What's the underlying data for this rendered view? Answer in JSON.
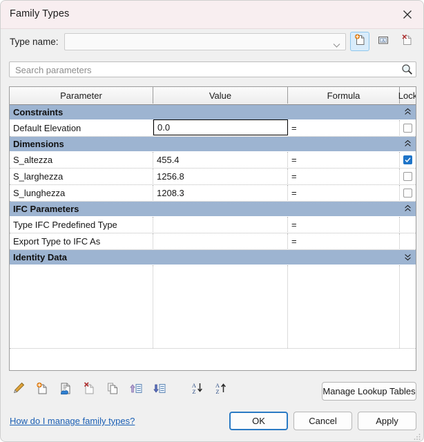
{
  "window": {
    "title": "Family Types",
    "close_icon": "close-icon"
  },
  "type_name": {
    "label": "Type name:",
    "value": "",
    "caret_icon": "chevron-down-icon",
    "buttons": [
      {
        "name": "new-type-button",
        "tooltip": "New Type",
        "icon": "new-document-icon",
        "state": "hovered"
      },
      {
        "name": "rename-type-button",
        "tooltip": "Rename",
        "icon": "rename-icon",
        "state": "normal"
      },
      {
        "name": "delete-type-button",
        "tooltip": "Delete",
        "icon": "delete-document-icon",
        "state": "normal"
      }
    ]
  },
  "search": {
    "placeholder": "Search parameters",
    "value": "",
    "icon": "search-icon"
  },
  "table": {
    "columns": [
      "Parameter",
      "Value",
      "Formula",
      "Lock"
    ],
    "groups": [
      {
        "label": "Constraints",
        "collapse_icon": "chevron-up-icon",
        "rows": [
          {
            "parameter": "Default Elevation",
            "value": "0.0",
            "formula": "=",
            "lock": false,
            "focused": true
          }
        ]
      },
      {
        "label": "Dimensions",
        "collapse_icon": "chevron-up-icon",
        "rows": [
          {
            "parameter": "S_altezza",
            "value": "455.4",
            "formula": "=",
            "lock": true,
            "focused": false
          },
          {
            "parameter": "S_larghezza",
            "value": "1256.8",
            "formula": "=",
            "lock": false,
            "focused": false
          },
          {
            "parameter": "S_lunghezza",
            "value": "1208.3",
            "formula": "=",
            "lock": false,
            "focused": false
          }
        ]
      },
      {
        "label": "IFC Parameters",
        "collapse_icon": "chevron-up-icon",
        "rows": [
          {
            "parameter": "Type IFC Predefined Type",
            "value": "",
            "formula": "=",
            "lock": null,
            "focused": false
          },
          {
            "parameter": "Export Type to IFC As",
            "value": "",
            "formula": "=",
            "lock": null,
            "focused": false
          }
        ]
      },
      {
        "label": "Identity Data",
        "collapse_icon": "chevron-down-icon",
        "rows": []
      }
    ]
  },
  "toolbar": {
    "buttons": [
      {
        "name": "edit-parameter-button",
        "icon": "pencil-icon",
        "tooltip": "Edit Parameter"
      },
      {
        "name": "new-parameter-button",
        "icon": "new-parameter-icon",
        "tooltip": "New Parameter"
      },
      {
        "name": "manage-shared-params-button",
        "icon": "shared-parameter-icon",
        "tooltip": "Manage Shared Parameters"
      },
      {
        "name": "remove-parameter-button",
        "icon": "remove-parameter-icon",
        "tooltip": "Remove Parameter"
      },
      {
        "name": "duplicate-parameter-button",
        "icon": "duplicate-icon",
        "tooltip": "Duplicate"
      },
      {
        "name": "move-parameter-up-button",
        "icon": "move-up-icon",
        "tooltip": "Move Up"
      },
      {
        "name": "move-parameter-down-button",
        "icon": "move-down-icon",
        "tooltip": "Move Down"
      },
      {
        "name": "sort-ascending-button",
        "icon": "sort-ascending-icon",
        "tooltip": "Sort Ascending"
      },
      {
        "name": "sort-descending-button",
        "icon": "sort-descending-icon",
        "tooltip": "Sort Descending"
      }
    ],
    "manage_lookup_tables_label": "Manage Lookup Tables"
  },
  "footer": {
    "help_link": "How do I manage family types?",
    "ok_label": "OK",
    "cancel_label": "Cancel",
    "apply_label": "Apply"
  },
  "colors": {
    "titlebar": "#f8eef0",
    "group_header": "#9db4d1",
    "checkbox_checked": "#1e74c8",
    "link": "#1a5fb4",
    "default_button_border": "#2a7ac4"
  }
}
